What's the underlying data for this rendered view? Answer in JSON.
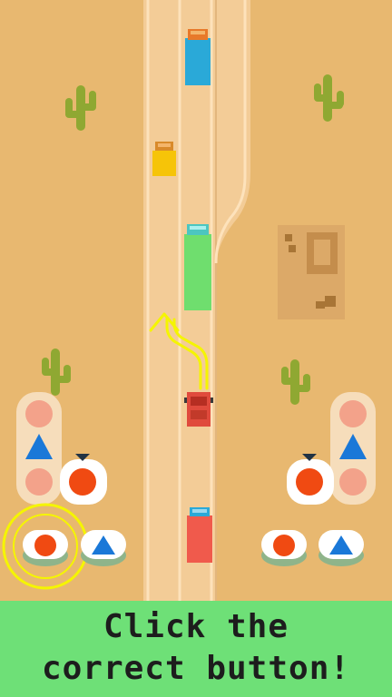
{
  "game": {
    "banner_line1": "Click the",
    "banner_line2": "correct button!",
    "colors": {
      "sand": "#e8b870",
      "road": "#f3cc97",
      "cactus": "#8fa832",
      "red": "#f04a12",
      "blue": "#1a78d8",
      "green_banner": "#6ee077",
      "highlight": "#f5f500"
    },
    "left_panel": {
      "queue": [
        "circle",
        "triangle",
        "circle"
      ],
      "active": "circle"
    },
    "right_panel": {
      "queue": [
        "circle",
        "triangle",
        "circle"
      ],
      "active": "circle"
    },
    "buttons": [
      {
        "side": "left",
        "shape": "circle",
        "highlighted": true
      },
      {
        "side": "left",
        "shape": "triangle",
        "highlighted": false
      },
      {
        "side": "right",
        "shape": "circle",
        "highlighted": false
      },
      {
        "side": "right",
        "shape": "triangle",
        "highlighted": false
      }
    ],
    "vehicles": [
      {
        "type": "truck",
        "color": "blue"
      },
      {
        "type": "car",
        "color": "yellow"
      },
      {
        "type": "truck",
        "color": "green"
      },
      {
        "type": "car",
        "color": "red",
        "player": true
      },
      {
        "type": "truck",
        "color": "red"
      }
    ],
    "hint_arrow": "path-arrow-icon"
  }
}
